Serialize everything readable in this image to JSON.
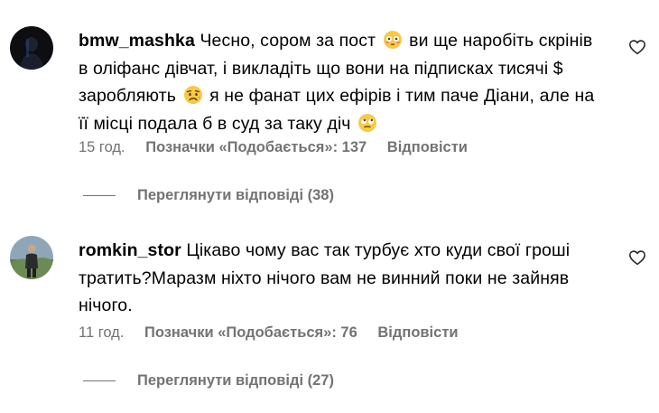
{
  "comments": [
    {
      "username": "bmw_mashka",
      "segments": [
        "Чесно, сором за пост",
        "ви ще наробіть скрінів в оліфанс дівчат, і викладіть що вони на підписках тисячі $ заробляють",
        "я не фанат цих ефірів і тим паче Діани, але на її місці подала б в суд за таку діч"
      ],
      "emojis": [
        "flushed-face-icon",
        "worried-face-icon",
        "face-with-rolling-eyes-icon"
      ],
      "time": "15 год.",
      "likes": "Позначки «Подобається»: 137",
      "reply": "Відповісти",
      "view_replies": "Переглянути відповіді (38)"
    },
    {
      "username": "romkin_stor",
      "text": "Цікаво чому вас так турбує хто куди свої гроші тратить?Маразм ніхто нічого вам не винний поки не зайняв нічого.",
      "time": "11 год.",
      "likes": "Позначки «Подобається»: 76",
      "reply": "Відповісти",
      "view_replies": "Переглянути відповіді (27)"
    }
  ]
}
